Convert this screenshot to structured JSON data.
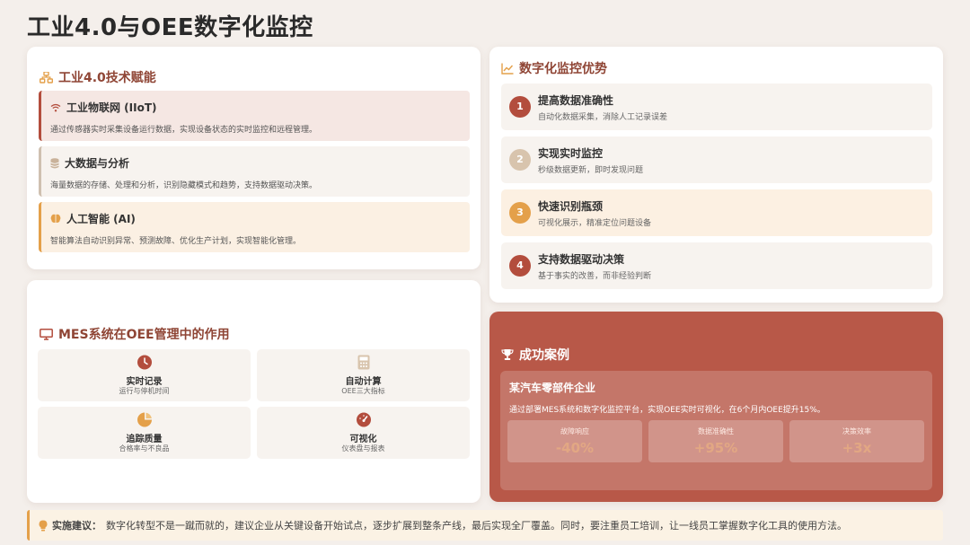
{
  "page": {
    "title": "工业4.0与OEE数字化监控"
  },
  "tech": {
    "header": "工业4.0技术赋能",
    "header_icon": "network-icon",
    "items": [
      {
        "icon": "wifi-icon",
        "title": "工业物联网 (IIoT)",
        "desc": "通过传感器实时采集设备运行数据，实现设备状态的实时监控和远程管理。"
      },
      {
        "icon": "database-icon",
        "title": "大数据与分析",
        "desc": "海量数据的存储、处理和分析，识别隐藏模式和趋势，支持数据驱动决策。"
      },
      {
        "icon": "brain-icon",
        "title": "人工智能 (AI)",
        "desc": "智能算法自动识别异常、预测故障、优化生产计划，实现智能化管理。"
      }
    ]
  },
  "mes": {
    "header": "MES系统在OEE管理中的作用",
    "header_icon": "monitor-icon",
    "tiles": [
      {
        "icon": "clock-icon",
        "title": "实时记录",
        "sub": "运行与停机时间"
      },
      {
        "icon": "calculator-icon",
        "title": "自动计算",
        "sub": "OEE三大指标"
      },
      {
        "icon": "pie-chart-icon",
        "title": "追踪质量",
        "sub": "合格率与不良品"
      },
      {
        "icon": "gauge-icon",
        "title": "可视化",
        "sub": "仪表盘与报表"
      }
    ]
  },
  "advantages": {
    "header": "数字化监控优势",
    "header_icon": "line-chart-icon",
    "items": [
      {
        "num": "1",
        "title": "提高数据准确性",
        "desc": "自动化数据采集，消除人工记录误差",
        "color": "#b34d3d"
      },
      {
        "num": "2",
        "title": "实现实时监控",
        "desc": "秒级数据更新，即时发现问题",
        "color": "#d8c4ad"
      },
      {
        "num": "3",
        "title": "快速识别瓶颈",
        "desc": "可视化展示，精准定位问题设备",
        "color": "#e4a04a"
      },
      {
        "num": "4",
        "title": "支持数据驱动决策",
        "desc": "基于事实的改善，而非经验判断",
        "color": "#b34d3d"
      }
    ]
  },
  "case": {
    "header": "成功案例",
    "header_icon": "trophy-icon",
    "company": "某汽车零部件企业",
    "desc": "通过部署MES系统和数字化监控平台，实现OEE实时可视化，在6个月内OEE提升15%。",
    "metrics": [
      {
        "label": "故障响应",
        "value": "-40%"
      },
      {
        "label": "数据准确性",
        "value": "+95%"
      },
      {
        "label": "决策效率",
        "value": "+3x"
      }
    ]
  },
  "tip": {
    "icon": "lightbulb-icon",
    "label": "实施建议：",
    "text": "数字化转型不是一蹴而就的，建议企业从关键设备开始试点，逐步扩展到整条产线，最后实现全厂覆盖。同时，要注重员工培训，让一线员工掌握数字化工具的使用方法。"
  },
  "colors": {
    "accent_red": "#b34d3d",
    "accent_orange": "#e4a04a",
    "accent_beige": "#d8c4ad",
    "case_bg": "#b85848"
  }
}
